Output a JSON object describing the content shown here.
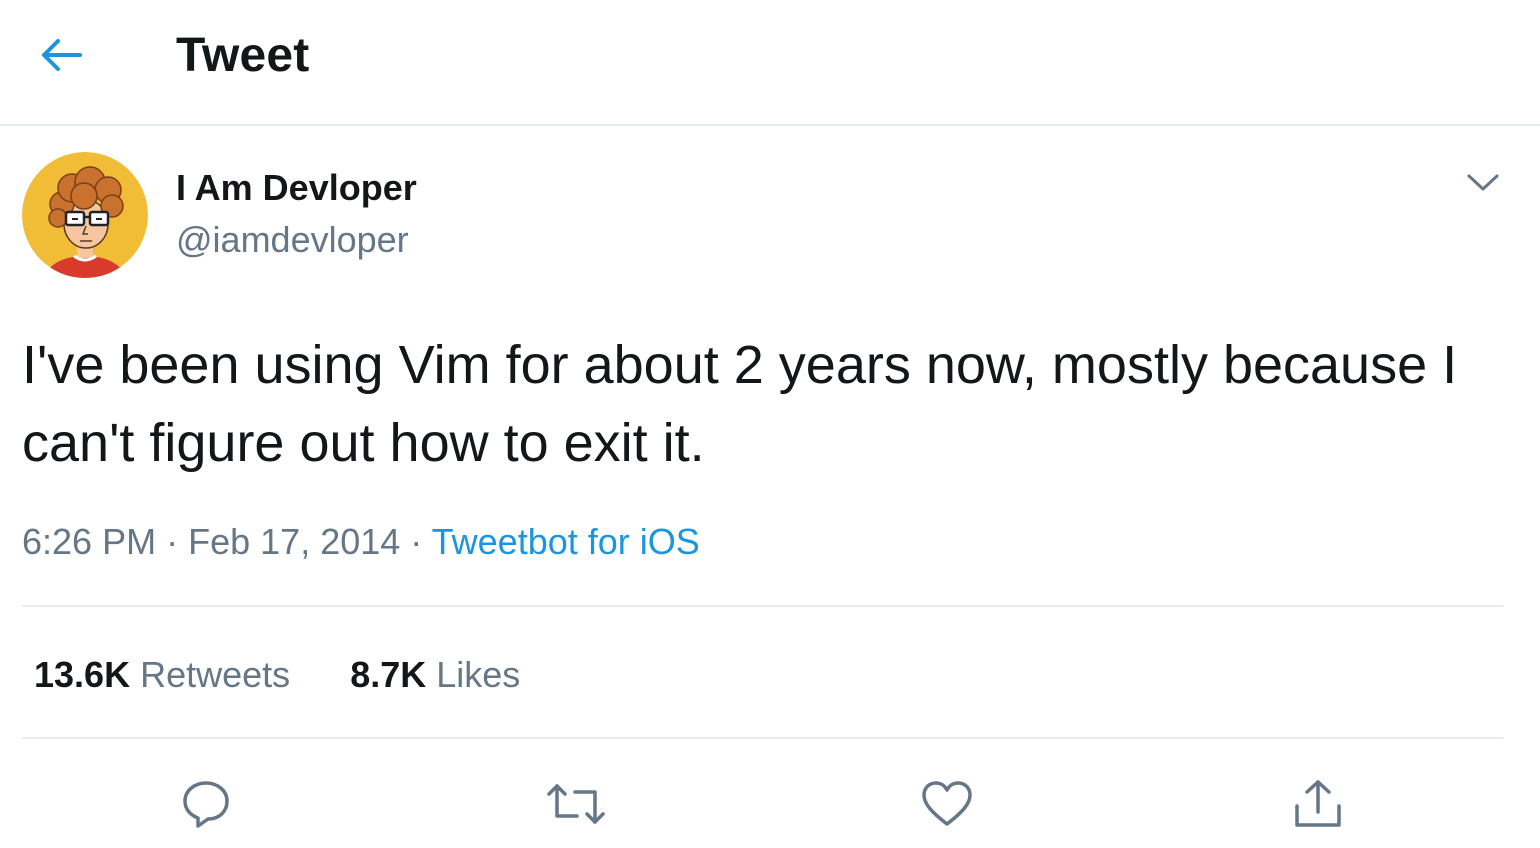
{
  "header": {
    "title": "Tweet",
    "back_icon": "arrow-left-icon",
    "accent_color": "#1b95e0"
  },
  "author": {
    "display_name": "I Am Devloper",
    "handle": "@iamdevloper",
    "avatar_icon": "cartoon-developer-avatar",
    "more_icon": "chevron-down-icon"
  },
  "tweet": {
    "text": "I've been using Vim for about 2 years now, mostly because I can't figure out how to exit it.",
    "time": "6:26 PM",
    "separator": "·",
    "date": "Feb 17, 2014",
    "source": "Tweetbot for iOS"
  },
  "stats": {
    "retweets_count": "13.6K",
    "retweets_label": "Retweets",
    "likes_count": "8.7K",
    "likes_label": "Likes"
  },
  "actions": [
    {
      "icon": "reply-icon"
    },
    {
      "icon": "retweet-icon"
    },
    {
      "icon": "like-icon"
    },
    {
      "icon": "share-icon"
    }
  ],
  "colors": {
    "text_primary": "#14171a",
    "text_secondary": "#657786",
    "link": "#1b95e0",
    "divider": "#e6ecf0",
    "avatar_background": "#f2bd36"
  }
}
